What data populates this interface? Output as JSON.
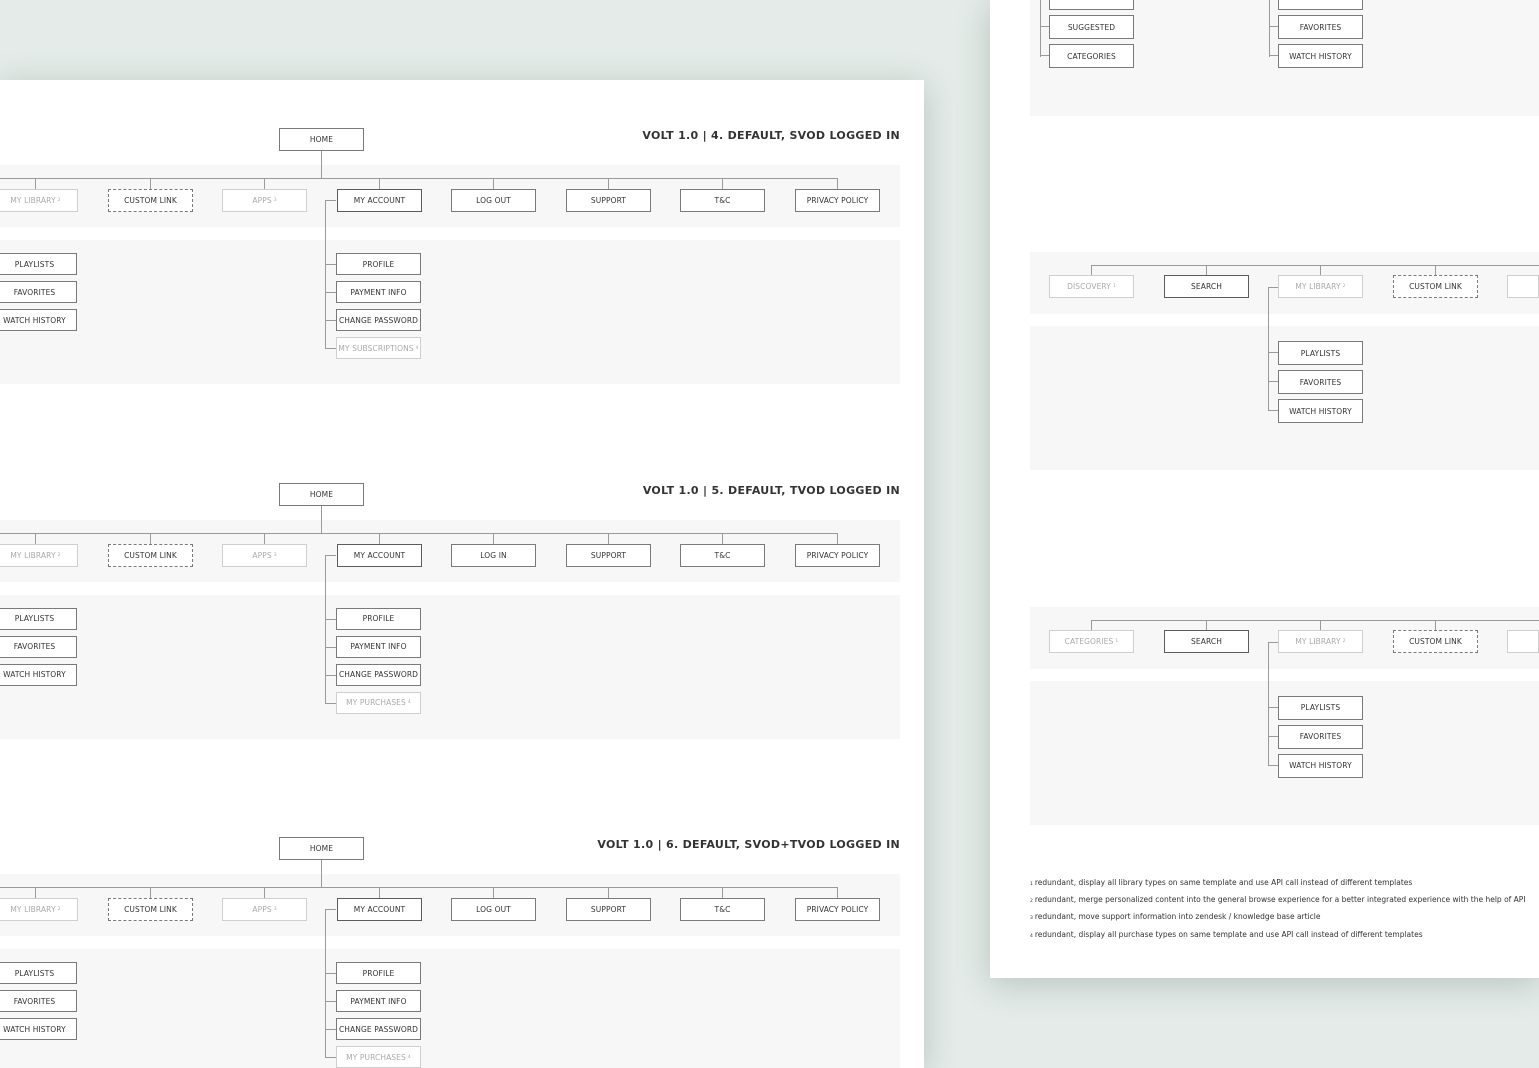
{
  "colors": {
    "background": "#e4ebe8",
    "sheet": "#ffffff",
    "band": "#f7f7f7",
    "line": "#9a9a9a"
  },
  "left_sheet": {
    "sections": [
      {
        "title": "VOLT 1.0 | 4. DEFAULT, SVOD LOGGED IN",
        "home": "HOME",
        "nav": [
          {
            "label": "MY LIBRARY",
            "sup": "2",
            "style": "muted"
          },
          {
            "label": "CUSTOM LINK",
            "style": "dashed"
          },
          {
            "label": "APPS",
            "sup": "3",
            "style": "muted"
          },
          {
            "label": "MY ACCOUNT",
            "style": "strong"
          },
          {
            "label": "LOG OUT",
            "style": "normal"
          },
          {
            "label": "SUPPORT",
            "style": "normal"
          },
          {
            "label": "T&C",
            "style": "normal"
          },
          {
            "label": "PRIVACY POLICY",
            "style": "normal"
          }
        ],
        "library_children": [
          {
            "label": "PLAYLISTS"
          },
          {
            "label": "FAVORITES"
          },
          {
            "label": "WATCH HISTORY"
          }
        ],
        "account_children": [
          {
            "label": "PROFILE",
            "style": "normal"
          },
          {
            "label": "PAYMENT INFO",
            "style": "normal"
          },
          {
            "label": "CHANGE PASSWORD",
            "style": "normal"
          },
          {
            "label": "MY SUBSCRIPTIONS",
            "sup": "4",
            "style": "muted"
          }
        ]
      },
      {
        "title": "VOLT 1.0 | 5. DEFAULT, TVOD LOGGED IN",
        "home": "HOME",
        "nav": [
          {
            "label": "MY LIBRARY",
            "sup": "2",
            "style": "muted"
          },
          {
            "label": "CUSTOM LINK",
            "style": "dashed"
          },
          {
            "label": "APPS",
            "sup": "3",
            "style": "muted"
          },
          {
            "label": "MY ACCOUNT",
            "style": "strong"
          },
          {
            "label": "LOG IN",
            "style": "normal"
          },
          {
            "label": "SUPPORT",
            "style": "normal"
          },
          {
            "label": "T&C",
            "style": "normal"
          },
          {
            "label": "PRIVACY POLICY",
            "style": "normal"
          }
        ],
        "library_children": [
          {
            "label": "PLAYLISTS"
          },
          {
            "label": "FAVORITES"
          },
          {
            "label": "WATCH HISTORY"
          }
        ],
        "account_children": [
          {
            "label": "PROFILE",
            "style": "normal"
          },
          {
            "label": "PAYMENT INFO",
            "style": "normal"
          },
          {
            "label": "CHANGE PASSWORD",
            "style": "normal"
          },
          {
            "label": "MY PURCHASES",
            "sup": "4",
            "style": "muted"
          }
        ]
      },
      {
        "title": "VOLT 1.0 | 6. DEFAULT, SVOD+TVOD LOGGED IN",
        "home": "HOME",
        "nav": [
          {
            "label": "MY LIBRARY",
            "sup": "2",
            "style": "muted"
          },
          {
            "label": "CUSTOM LINK",
            "style": "dashed"
          },
          {
            "label": "APPS",
            "sup": "3",
            "style": "muted"
          },
          {
            "label": "MY ACCOUNT",
            "style": "strong"
          },
          {
            "label": "LOG OUT",
            "style": "normal"
          },
          {
            "label": "SUPPORT",
            "style": "normal"
          },
          {
            "label": "T&C",
            "style": "normal"
          },
          {
            "label": "PRIVACY POLICY",
            "style": "normal"
          }
        ],
        "library_children": [
          {
            "label": "PLAYLISTS"
          },
          {
            "label": "FAVORITES"
          },
          {
            "label": "WATCH HISTORY"
          }
        ],
        "account_children": [
          {
            "label": "PROFILE",
            "style": "normal"
          },
          {
            "label": "PAYMENT INFO",
            "style": "normal"
          },
          {
            "label": "CHANGE PASSWORD",
            "style": "normal"
          },
          {
            "label": "MY PURCHASES",
            "sup": "4",
            "style": "muted"
          }
        ]
      }
    ]
  },
  "right_sheet": {
    "top_section": {
      "column_a": [
        {
          "label": ""
        },
        {
          "label": "SUGGESTED"
        },
        {
          "label": "CATEGORIES"
        }
      ],
      "column_b": [
        {
          "label": ""
        },
        {
          "label": "FAVORITES"
        },
        {
          "label": "WATCH HISTORY"
        }
      ]
    },
    "sections": [
      {
        "nav": [
          {
            "label": "DISCOVERY",
            "sup": "1",
            "style": "muted"
          },
          {
            "label": "SEARCH",
            "style": "strong"
          },
          {
            "label": "MY LIBRARY",
            "sup": "2",
            "style": "muted"
          },
          {
            "label": "CUSTOM LINK",
            "style": "dashed"
          },
          {
            "label": "",
            "style": "muted"
          }
        ],
        "library_children": [
          {
            "label": "PLAYLISTS"
          },
          {
            "label": "FAVORITES"
          },
          {
            "label": "WATCH HISTORY"
          }
        ]
      },
      {
        "nav": [
          {
            "label": "CATEGORIES",
            "sup": "1",
            "style": "muted"
          },
          {
            "label": "SEARCH",
            "style": "strong"
          },
          {
            "label": "MY LIBRARY",
            "sup": "2",
            "style": "muted"
          },
          {
            "label": "CUSTOM LINK",
            "style": "dashed"
          },
          {
            "label": "",
            "style": "muted"
          }
        ],
        "library_children": [
          {
            "label": "PLAYLISTS"
          },
          {
            "label": "FAVORITES"
          },
          {
            "label": "WATCH HISTORY"
          }
        ]
      }
    ],
    "footnotes": [
      {
        "num": "1",
        "text": "redundant, display all library types on same template and use API call instead of different templates"
      },
      {
        "num": "2",
        "text": "redundant, merge personalized content into the general browse experience for a better integrated experience with the help of API"
      },
      {
        "num": "3",
        "text": "redundant, move support information into zendesk / knowledge base article"
      },
      {
        "num": "4",
        "text": "redundant, display all purchase types on same template and use API call instead of different templates"
      }
    ]
  }
}
